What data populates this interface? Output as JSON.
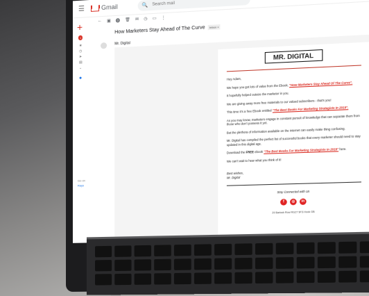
{
  "app": {
    "name": "Gmail"
  },
  "search": {
    "placeholder": "Search mail"
  },
  "sidebar": {
    "badge": "1",
    "meet": "Go on",
    "meet2": "Rays"
  },
  "toolbar": {
    "icons": [
      "back-icon",
      "archive-icon",
      "report-icon",
      "delete-icon",
      "mail-icon",
      "clock-icon",
      "label-icon",
      "more-icon"
    ]
  },
  "email": {
    "subject": "How Marketers Stay Ahead of The Curve",
    "inbox_tag": "Inbox ×",
    "sender": "Mr. Digital",
    "to": "to me",
    "brand": "MR. DIGITAL",
    "greeting": "Hey Adam,",
    "p1_pre": "We hope you got lots of value from the Ebook,",
    "p1_link": "\"How Marketers Stay Ahead Of The Curve\".",
    "p2": "It hopefully helped outsize the marketer in you.",
    "p3": "We are giving away more free materials to our valued subscribers - that's you!",
    "p4_pre": "This time it's a free Ebook entitled",
    "p4_link": "\"The Best Books For Marketing Strategists In 2019\".",
    "p5": "As you may know, marketers engage in constant pursuit of knowledge that can separate them from those who don't possess it yet.",
    "p6": "But the plethora of information available on the internet can easily make thing confusing.",
    "p7": "Mr. Digital has compiled the perfect list of successful books that every marketer should need to stay updated in this digital age.",
    "p8_pre": "Download the",
    "p8_free": "FREE",
    "p8_mid": "ebook",
    "p8_link": "\"The Best Books For Marketing Strategists In 2019\"",
    "p8_post": "here.",
    "p9": "We can't wait to hear what you think of it!",
    "signoff": "Best wishes,",
    "signature": "Mr. Digital",
    "stay": "Stay Connected with Us",
    "socials": [
      "f",
      "◎",
      "in"
    ],
    "address": "29 Barlock Row RG27 9FS Hook GB"
  }
}
